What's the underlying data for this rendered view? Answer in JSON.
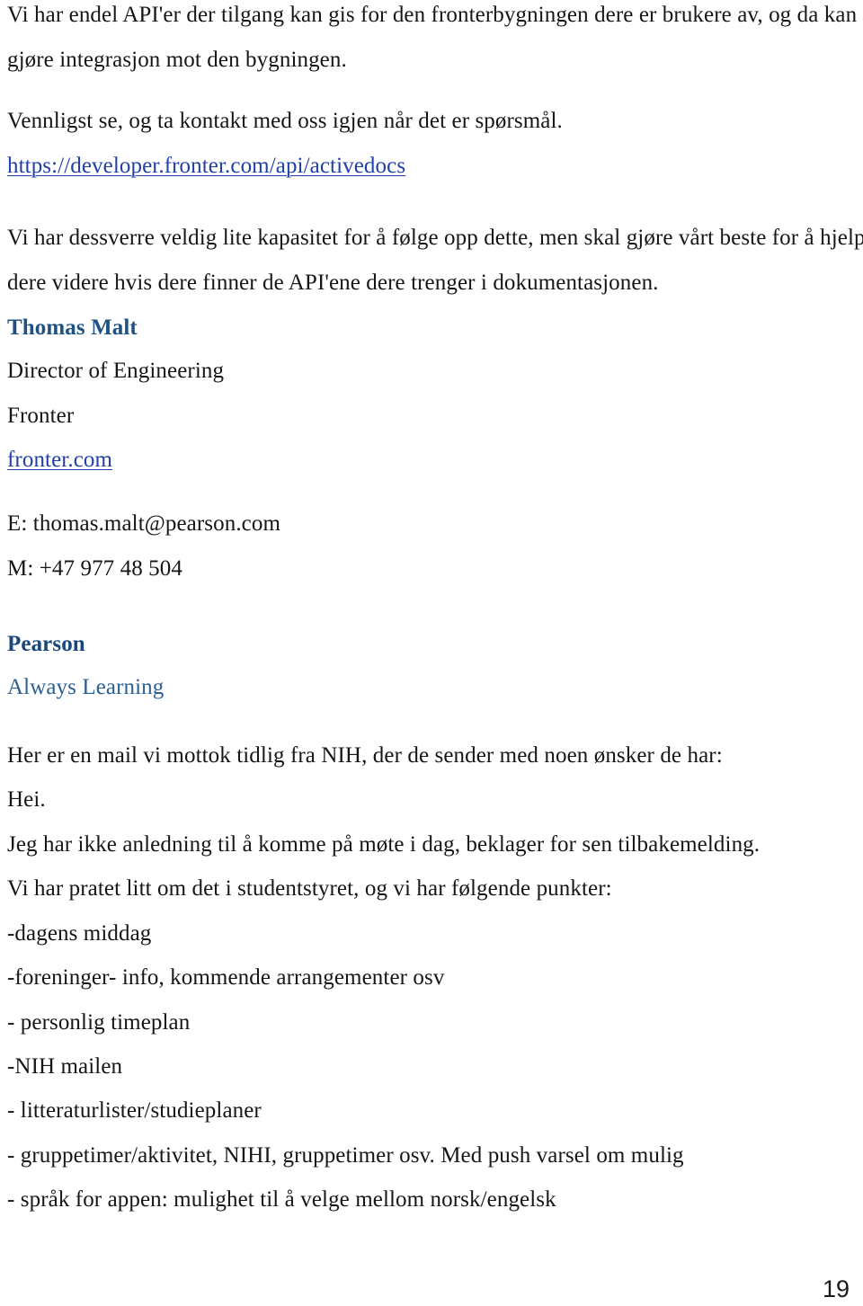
{
  "document": {
    "page_number": "19",
    "language": "no",
    "colors": {
      "text": "#161616",
      "link": "#2040a8",
      "signature_name": "#1f5282",
      "brand": "#17477c",
      "tagline": "#2a6094",
      "background": "#ffffff"
    }
  },
  "body": {
    "paragraph_1": {
      "line_1": "Vi har endel API'er der tilgang kan gis for den fronterbygningen dere er brukere av, og da kan dere",
      "line_2": "gjøre integrasjon mot den bygningen."
    },
    "paragraph_2": {
      "line_1": "Vennligst se, og ta kontakt med oss igjen når det er spørsmål."
    },
    "developer_link": "https://developer.fronter.com/api/activedocs",
    "paragraph_3": {
      "line_1": "Vi har dessverre veldig lite kapasitet for å følge opp dette, men skal gjøre vårt beste for å hjelpe",
      "line_2": "dere videre hvis dere finner de API'ene dere trenger i dokumentasjonen."
    }
  },
  "signature": {
    "name": "Thomas Malt",
    "title": "Director of Engineering",
    "company": "Fronter",
    "website": "fronter.com",
    "email": "E: thomas.malt@pearson.com",
    "mobile": "M: +47 977 48 504",
    "brand": "Pearson",
    "tagline": "Always Learning"
  },
  "forwarded_email": {
    "intro": "Her er en mail vi mottok tidlig fra NIH, der de sender med noen ønsker de har:",
    "greeting": "Hei.",
    "paragraph_1": "Jeg har ikke anledning til å komme på møte i dag, beklager for sen tilbakemelding.",
    "paragraph_2": "Vi har pratet litt om det i studentstyret, og vi har følgende punkter:",
    "bullets": [
      "-dagens middag",
      "-foreninger- info, kommende arrangementer osv",
      "- personlig timeplan",
      "-NIH mailen",
      "- litteraturlister/studieplaner",
      "- gruppetimer/aktivitet, NIHI, gruppetimer osv. Med push varsel om mulig",
      "- språk for appen: mulighet til å velge mellom norsk/engelsk"
    ]
  }
}
